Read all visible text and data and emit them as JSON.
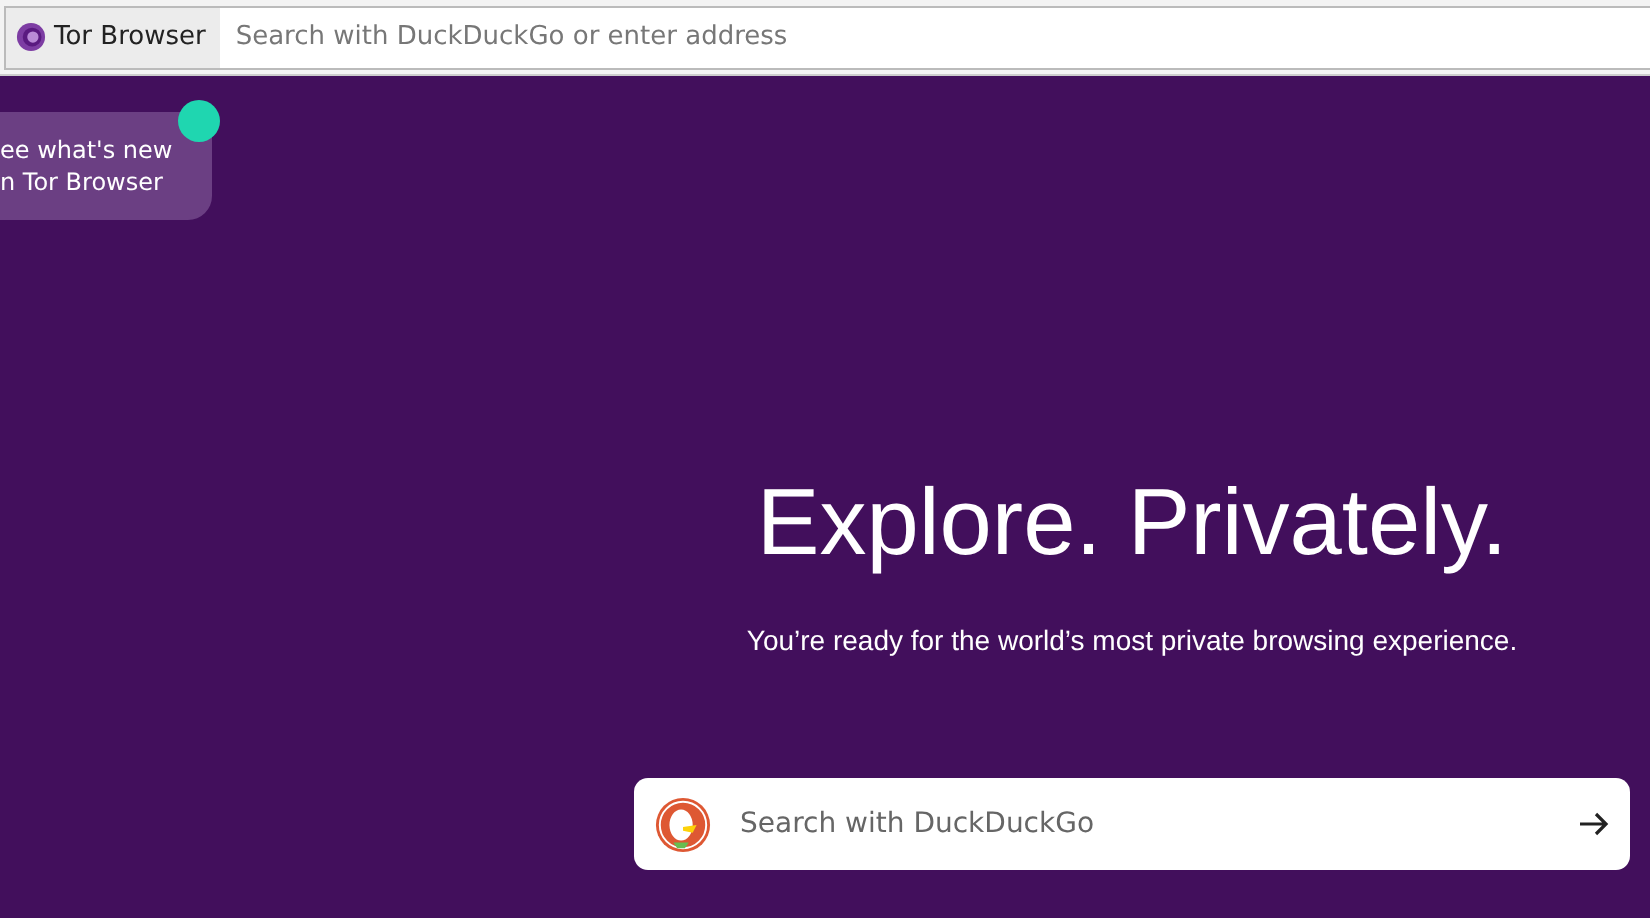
{
  "toolbar": {
    "identity_label": "Tor Browser",
    "address_placeholder": "Search with DuckDuckGo or enter address"
  },
  "whats_new": {
    "lines": [
      "ee what's new",
      "n Tor Browser"
    ],
    "unread": true
  },
  "hero": {
    "title": "Explore. Privately.",
    "subtitle": "You’re ready for the world’s most private browsing experience."
  },
  "search": {
    "placeholder": "Search with DuckDuckGo"
  }
}
